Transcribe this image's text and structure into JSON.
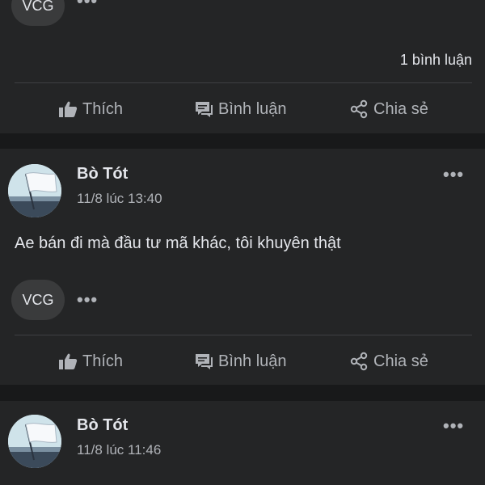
{
  "post_top": {
    "tag": "VCG",
    "comments": "1 bình luận",
    "actions": {
      "like": "Thích",
      "comment": "Bình luận",
      "share": "Chia sẻ"
    }
  },
  "post_mid": {
    "author": "Bò Tót",
    "time": "11/8 lúc 13:40",
    "text": "Ae bán đi mà đầu tư mã khác, tôi khuyên thật",
    "tag": "VCG",
    "actions": {
      "like": "Thích",
      "comment": "Bình luận",
      "share": "Chia sẻ"
    }
  },
  "post_bot": {
    "author": "Bò Tót",
    "time": "11/8 lúc 11:46"
  },
  "icons": {
    "more": "more-dots-icon",
    "like": "thumbs-up-icon",
    "comment": "speech-bubble-icon",
    "share": "share-icon"
  },
  "colors": {
    "background": "#18191a",
    "card": "#242526",
    "text": "#e4e6eb",
    "muted": "#b0b3b8",
    "tag_bg": "#3a3b3c"
  }
}
